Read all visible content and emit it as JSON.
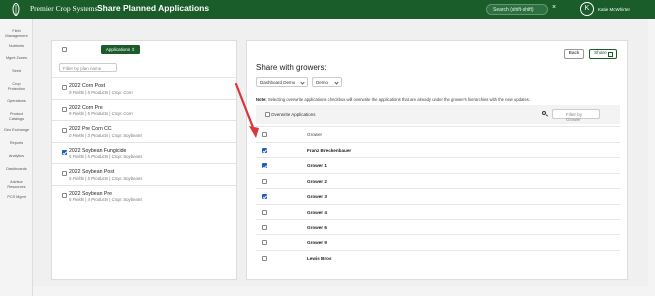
{
  "header": {
    "brand": "Premier Crop Systems",
    "title": "Share Planned Applications",
    "search_placeholder": "Search (shift-shift)",
    "clear_glyph": "×",
    "avatar_initial": "K",
    "user_name": "Katie McWhirter"
  },
  "sidebar": {
    "items": [
      [
        "Field",
        "Management"
      ],
      [
        "Nutrients"
      ],
      [
        "Mgmt Zones"
      ],
      [
        "Seed"
      ],
      [
        "Crop",
        "Protection"
      ],
      [
        "Operations"
      ],
      [
        "Product",
        "Catalogs"
      ],
      [
        "Geo Exchange"
      ],
      [
        "Reports"
      ],
      [
        "Analytics"
      ],
      [
        "Dashboards"
      ],
      [
        "Advisor",
        "Resources"
      ],
      [
        "PCS Mgmt"
      ]
    ]
  },
  "plans": {
    "applications_button": "Applications ⇕",
    "filter_placeholder": "Filter by plan name",
    "items": [
      {
        "name": "2022 Corn Post",
        "details": "9 Fields | 5 Products | Crop: Corn",
        "checked": false
      },
      {
        "name": "2022 Corn Pre",
        "details": "9 Fields | 5 Products | Crop: Corn",
        "checked": false
      },
      {
        "name": "2022 Pre Corn CC",
        "details": "0 Fields | 3 Products | Crop: Soybeans",
        "checked": false
      },
      {
        "name": "2022 Soybean Fungicide",
        "details": "5 Fields | 5 Products | Crop: Soybeans",
        "checked": true
      },
      {
        "name": "2022 Soybean Post",
        "details": "5 Fields | 5 Products | Crop: Soybeans",
        "checked": false
      },
      {
        "name": "2022 Soybean Pre",
        "details": "5 Fields | 4 Products | Crop: Soybeans",
        "checked": false
      }
    ]
  },
  "share": {
    "back_label": "Back",
    "share_label": "Share",
    "heading": "Share with growers:",
    "dashboard_select": "Dashboard Demo",
    "demo_select": "Demo",
    "note_bold": "Note:",
    "note_text": " Selecting overwrite applications checkbox will overwrite the applications that are already under the grower's hierarchies with the new updates.",
    "overwrite_label": "Overwrite Applications",
    "filter_placeholder": "Filter by Grower",
    "column_header": "Grower",
    "growers": [
      {
        "name": "Franz Breckenbauer",
        "checked": true
      },
      {
        "name": "Grower 1",
        "checked": true
      },
      {
        "name": "Grower 2",
        "checked": false
      },
      {
        "name": "Grower 3",
        "checked": true
      },
      {
        "name": "Grower 4",
        "checked": false
      },
      {
        "name": "Grower 6",
        "checked": false
      },
      {
        "name": "Grower 9",
        "checked": false
      },
      {
        "name": "Lewis Bros",
        "checked": false
      }
    ]
  },
  "colors": {
    "brand_green": "#1a5c2a",
    "checkbox_blue": "#1f5fb5",
    "annotation_arrow": "#d9363e"
  },
  "icons": [
    "logo-leaf-icon",
    "close-icon",
    "sort-icon",
    "chevron-down-icon",
    "search-icon",
    "external-link-icon",
    "annotation-arrow"
  ]
}
